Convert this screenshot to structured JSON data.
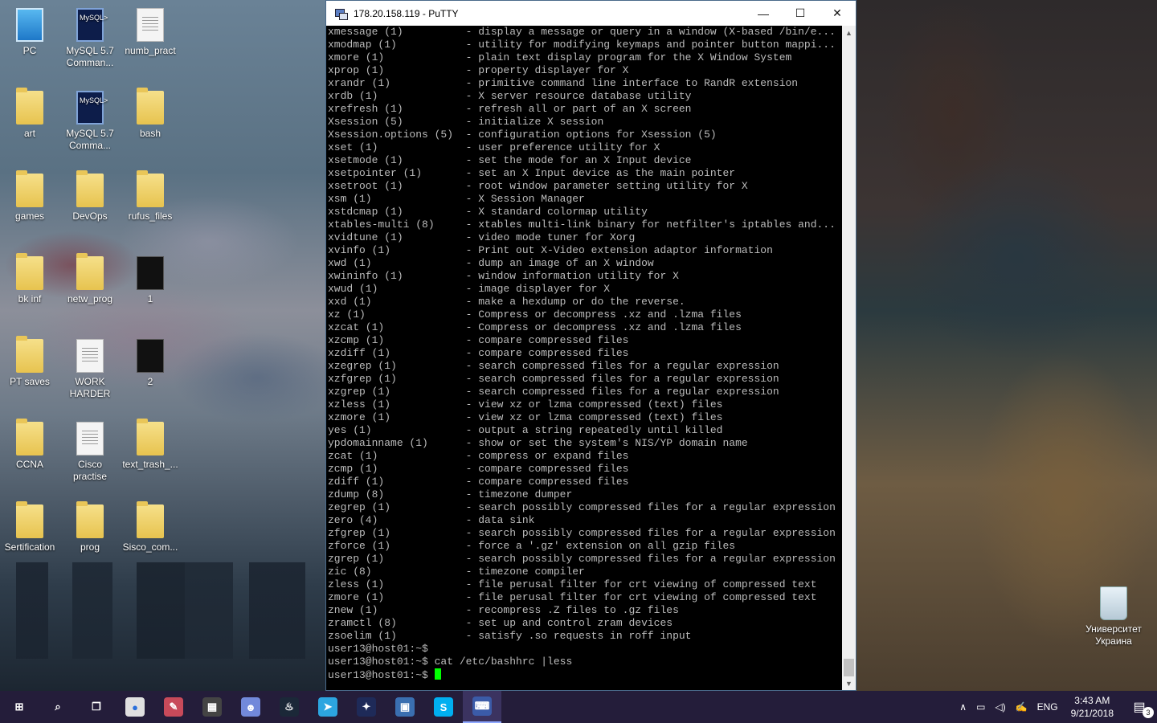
{
  "desktop": {
    "icons_left": [
      {
        "label": "PC",
        "kind": "pc"
      },
      {
        "label": "MySQL 5.7 Comman...",
        "kind": "mysql"
      },
      {
        "label": "numb_pract",
        "kind": "doc"
      },
      {
        "label": "art",
        "kind": "folder"
      },
      {
        "label": "MySQL 5.7 Comma...",
        "kind": "mysql"
      },
      {
        "label": "bash",
        "kind": "folder"
      },
      {
        "label": "games",
        "kind": "folder"
      },
      {
        "label": "DevOps",
        "kind": "folder"
      },
      {
        "label": "rufus_files",
        "kind": "folder"
      },
      {
        "label": "bk inf",
        "kind": "folder"
      },
      {
        "label": "netw_prog",
        "kind": "folder"
      },
      {
        "label": "1",
        "kind": "thumb"
      },
      {
        "label": "PT saves",
        "kind": "folder"
      },
      {
        "label": "WORK HARDER",
        "kind": "doc"
      },
      {
        "label": "2",
        "kind": "thumb"
      },
      {
        "label": "CCNA",
        "kind": "folder"
      },
      {
        "label": "Cisco practise",
        "kind": "doc"
      },
      {
        "label": "text_trash_...",
        "kind": "folder"
      },
      {
        "label": "Sertification",
        "kind": "folder"
      },
      {
        "label": "prog",
        "kind": "folder"
      },
      {
        "label": "Sisco_com...",
        "kind": "folder"
      }
    ],
    "recycle_bin": {
      "label": "Университет Украина",
      "icon": "recycle-bin-icon"
    }
  },
  "putty": {
    "title": "178.20.158.119 - PuTTY",
    "window_buttons": {
      "minimize": "—",
      "maximize": "☐",
      "close": "✕"
    },
    "lines": [
      "xmessage (1)          - display a message or query in a window (X-based /bin/e...",
      "xmodmap (1)           - utility for modifying keymaps and pointer button mappi...",
      "xmore (1)             - plain text display program for the X Window System",
      "xprop (1)             - property displayer for X",
      "xrandr (1)            - primitive command line interface to RandR extension",
      "xrdb (1)              - X server resource database utility",
      "xrefresh (1)          - refresh all or part of an X screen",
      "Xsession (5)          - initialize X session",
      "Xsession.options (5)  - configuration options for Xsession (5)",
      "xset (1)              - user preference utility for X",
      "xsetmode (1)          - set the mode for an X Input device",
      "xsetpointer (1)       - set an X Input device as the main pointer",
      "xsetroot (1)          - root window parameter setting utility for X",
      "xsm (1)               - X Session Manager",
      "xstdcmap (1)          - X standard colormap utility",
      "xtables-multi (8)     - xtables multi-link binary for netfilter's iptables and...",
      "xvidtune (1)          - video mode tuner for Xorg",
      "xvinfo (1)            - Print out X-Video extension adaptor information",
      "xwd (1)               - dump an image of an X window",
      "xwininfo (1)          - window information utility for X",
      "xwud (1)              - image displayer for X",
      "xxd (1)               - make a hexdump or do the reverse.",
      "xz (1)                - Compress or decompress .xz and .lzma files",
      "xzcat (1)             - Compress or decompress .xz and .lzma files",
      "xzcmp (1)             - compare compressed files",
      "xzdiff (1)            - compare compressed files",
      "xzegrep (1)           - search compressed files for a regular expression",
      "xzfgrep (1)           - search compressed files for a regular expression",
      "xzgrep (1)            - search compressed files for a regular expression",
      "xzless (1)            - view xz or lzma compressed (text) files",
      "xzmore (1)            - view xz or lzma compressed (text) files",
      "yes (1)               - output a string repeatedly until killed",
      "ypdomainname (1)      - show or set the system's NIS/YP domain name",
      "zcat (1)              - compress or expand files",
      "zcmp (1)              - compare compressed files",
      "zdiff (1)             - compare compressed files",
      "zdump (8)             - timezone dumper",
      "zegrep (1)            - search possibly compressed files for a regular expression",
      "zero (4)              - data sink",
      "zfgrep (1)            - search possibly compressed files for a regular expression",
      "zforce (1)            - force a '.gz' extension on all gzip files",
      "zgrep (1)             - search possibly compressed files for a regular expression",
      "zic (8)               - timezone compiler",
      "zless (1)             - file perusal filter for crt viewing of compressed text",
      "zmore (1)             - file perusal filter for crt viewing of compressed text",
      "znew (1)              - recompress .Z files to .gz files",
      "zramctl (8)           - set up and control zram devices",
      "zsoelim (1)           - satisfy .so requests in roff input",
      "user13@host01:~$",
      "user13@host01:~$ cat /etc/bashhrc |less"
    ],
    "prompt": "user13@host01:~$ ",
    "colors": {
      "background": "#000000",
      "text": "#bbbbbb",
      "cursor": "#00ff00"
    }
  },
  "taskbar": {
    "apps": [
      {
        "name": "start",
        "glyph": "⊞"
      },
      {
        "name": "search",
        "glyph": "⌕"
      },
      {
        "name": "task-view",
        "glyph": "❐"
      },
      {
        "name": "chrome",
        "glyph": "●"
      },
      {
        "name": "paint",
        "glyph": "✎"
      },
      {
        "name": "calculator",
        "glyph": "▦"
      },
      {
        "name": "discord",
        "glyph": "☻"
      },
      {
        "name": "steam",
        "glyph": "♨"
      },
      {
        "name": "telegram",
        "glyph": "➤"
      },
      {
        "name": "packet-tracer",
        "glyph": "✦"
      },
      {
        "name": "remote-desktop",
        "glyph": "▣"
      },
      {
        "name": "skype",
        "glyph": "S"
      },
      {
        "name": "putty",
        "glyph": "⌨"
      }
    ],
    "tray": {
      "chevron": "∧",
      "network": "▭",
      "volume": "◁)",
      "pen": "✍",
      "language": "ENG"
    },
    "clock": {
      "time": "3:43 AM",
      "date": "9/21/2018"
    },
    "notifications": {
      "count": "3"
    }
  }
}
